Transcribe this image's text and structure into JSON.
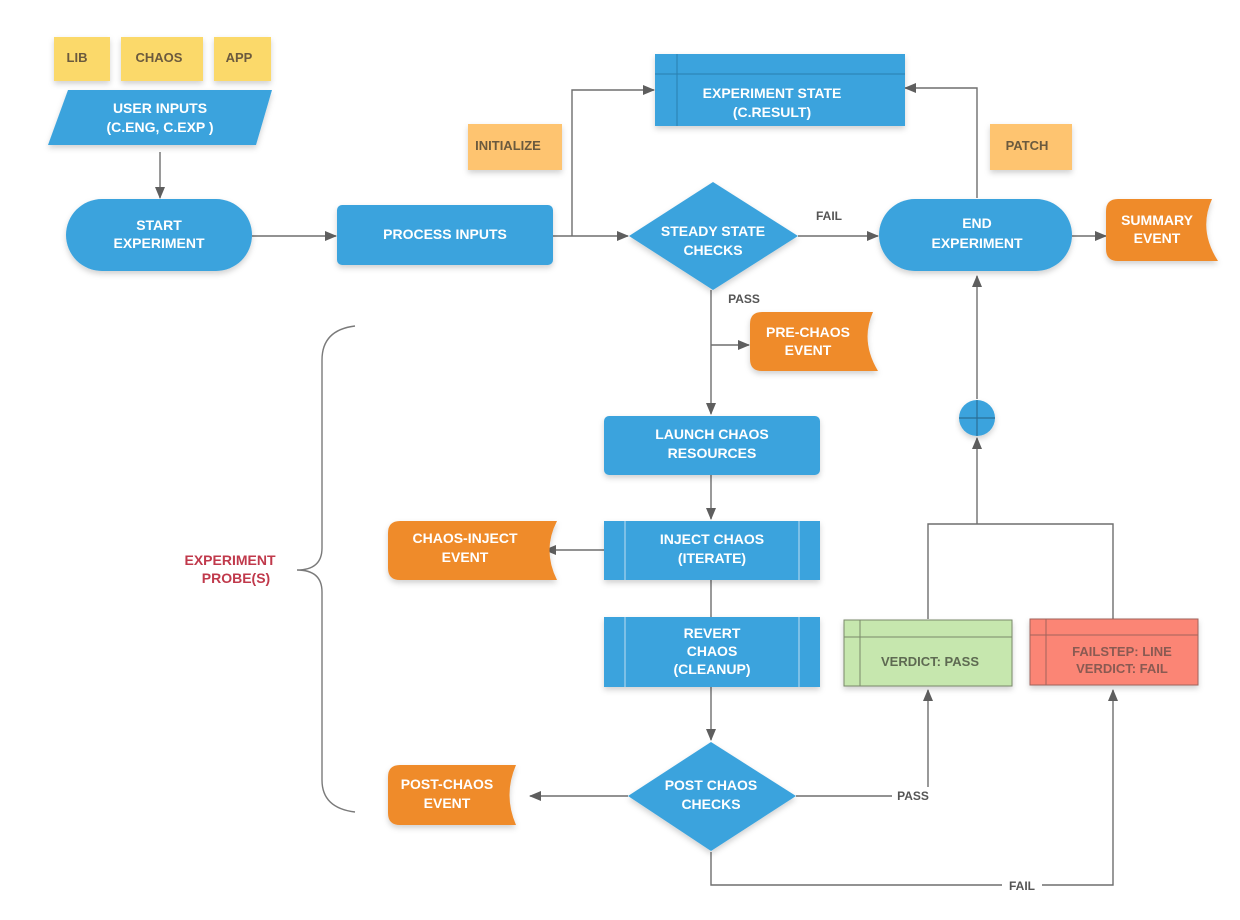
{
  "colors": {
    "process_blue": "#3ba3dd",
    "event_orange": "#ef8b2c",
    "note_yellow": "#fbd96a",
    "note_orange": "#fec46f",
    "pass_green": "#c6e7ae",
    "fail_red": "#fb8575",
    "connector": "#6e6e6e",
    "probe_label": "#c0394b"
  },
  "notes": {
    "lib": "LIB",
    "chaos": "CHAOS",
    "app": "APP",
    "initialize": "INITIALIZE",
    "patch": "PATCH"
  },
  "nodes": {
    "user_inputs": [
      "USER INPUTS",
      "(C.ENG, C.EXP )"
    ],
    "start_experiment": [
      "START",
      "EXPERIMENT"
    ],
    "process_inputs": [
      "PROCESS INPUTS"
    ],
    "experiment_state": [
      "EXPERIMENT STATE",
      "(C.RESULT)"
    ],
    "steady_state_checks": [
      "STEADY STATE",
      "CHECKS"
    ],
    "end_experiment": [
      "END",
      "EXPERIMENT"
    ],
    "summary_event": [
      "SUMMARY",
      "EVENT"
    ],
    "pre_chaos_event": [
      "PRE-CHAOS",
      "EVENT"
    ],
    "launch_chaos_resources": [
      "LAUNCH CHAOS",
      "RESOURCES"
    ],
    "inject_chaos": [
      "INJECT CHAOS",
      "(ITERATE)"
    ],
    "chaos_inject_event": [
      "CHAOS-INJECT",
      "EVENT"
    ],
    "revert_chaos": [
      "REVERT",
      "CHAOS",
      "(CLEANUP)"
    ],
    "post_chaos_checks": [
      "POST CHAOS",
      "CHECKS"
    ],
    "post_chaos_event": [
      "POST-CHAOS",
      "EVENT"
    ],
    "verdict_pass": [
      "VERDICT: PASS"
    ],
    "verdict_fail": [
      "FAILSTEP: LINE",
      "VERDICT: FAIL"
    ]
  },
  "edge_labels": {
    "steady_fail": "FAIL",
    "steady_pass": "PASS",
    "post_pass": "PASS",
    "post_fail": "FAIL"
  },
  "group": {
    "probe_label": [
      "EXPERIMENT",
      "PROBE(S)"
    ]
  }
}
